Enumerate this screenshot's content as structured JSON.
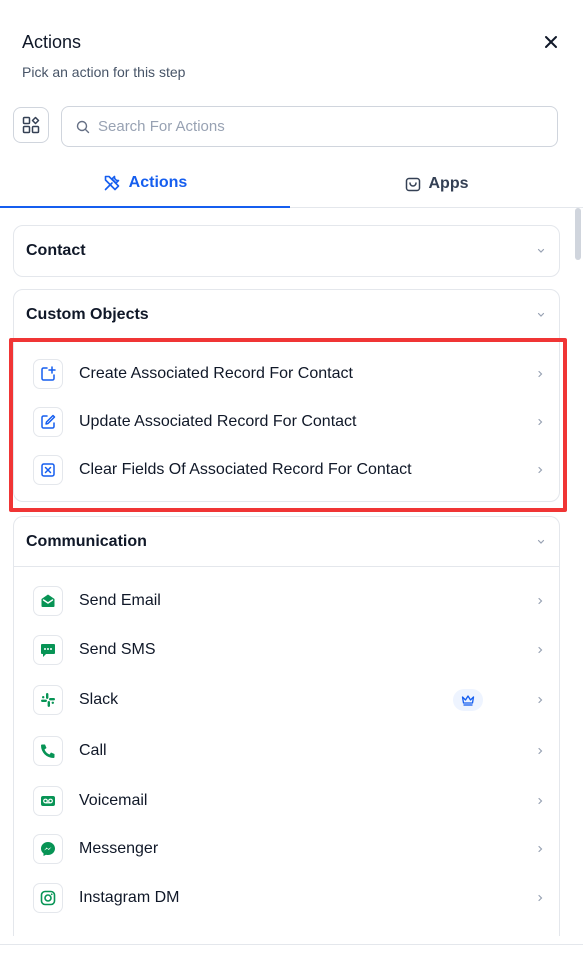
{
  "panel": {
    "title": "Actions",
    "subtitle": "Pick an action for this step"
  },
  "search": {
    "placeholder": "Search For Actions",
    "value": ""
  },
  "tabs": [
    {
      "label": "Actions",
      "icon": "tools-icon",
      "active": true
    },
    {
      "label": "Apps",
      "icon": "calendar-icon",
      "active": false
    }
  ],
  "sections": {
    "contact": {
      "label": "Contact",
      "expanded": false
    },
    "custom_objects": {
      "label": "Custom Objects",
      "expanded": true,
      "items": [
        {
          "label": "Create Associated Record For Contact",
          "icon": "add-record-icon"
        },
        {
          "label": "Update Associated Record For Contact",
          "icon": "edit-record-icon"
        },
        {
          "label": "Clear Fields Of Associated Record For Contact",
          "icon": "clear-record-icon"
        }
      ]
    },
    "communication": {
      "label": "Communication",
      "expanded": true,
      "items": [
        {
          "label": "Send Email",
          "icon": "email-icon"
        },
        {
          "label": "Send SMS",
          "icon": "sms-icon"
        },
        {
          "label": "Slack",
          "icon": "slack-icon",
          "premium": true
        },
        {
          "label": "Call",
          "icon": "phone-icon"
        },
        {
          "label": "Voicemail",
          "icon": "voicemail-icon"
        },
        {
          "label": "Messenger",
          "icon": "messenger-icon"
        },
        {
          "label": "Instagram DM",
          "icon": "instagram-icon"
        }
      ]
    }
  },
  "colors": {
    "accent": "#155eef",
    "communication_icon": "#079455",
    "highlight": "#f03535"
  }
}
